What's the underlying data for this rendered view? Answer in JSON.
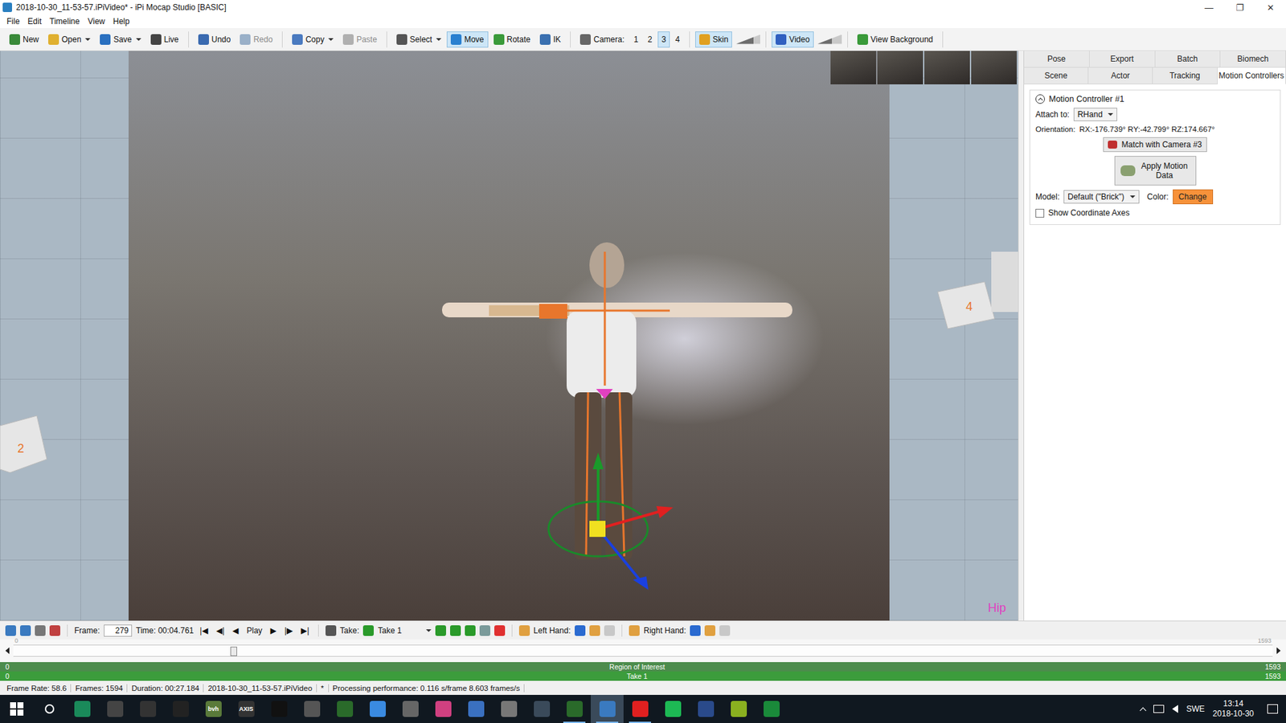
{
  "window": {
    "title": "2018-10-30_11-53-57.iPiVideo* - iPi Mocap Studio [BASIC]",
    "controls": [
      "—",
      "❐",
      "✕"
    ]
  },
  "menu": [
    "File",
    "Edit",
    "Timeline",
    "View",
    "Help"
  ],
  "toolbar": [
    [
      {
        "label": "New",
        "kind": "icon-button",
        "selected": false,
        "disabled": false,
        "dropdown": false,
        "opacity": null
      },
      {
        "label": "Open",
        "kind": "icon-button",
        "selected": false,
        "disabled": false,
        "dropdown": true,
        "opacity": null
      },
      {
        "label": "Save",
        "kind": "icon-button",
        "selected": false,
        "disabled": false,
        "dropdown": true,
        "opacity": null
      },
      {
        "label": "Live",
        "kind": "icon-button",
        "selected": false,
        "disabled": false,
        "dropdown": false,
        "opacity": null
      }
    ],
    [
      {
        "label": "Undo",
        "kind": "icon-button",
        "selected": false,
        "disabled": false,
        "dropdown": false,
        "opacity": null
      },
      {
        "label": "Redo",
        "kind": "icon-button",
        "selected": false,
        "disabled": true,
        "dropdown": false,
        "opacity": null
      }
    ],
    [
      {
        "label": "Copy",
        "kind": "icon-button",
        "selected": false,
        "disabled": false,
        "dropdown": true,
        "opacity": null
      },
      {
        "label": "Paste",
        "kind": "icon-button",
        "selected": false,
        "disabled": true,
        "dropdown": false,
        "opacity": null
      }
    ],
    [
      {
        "label": "Select",
        "kind": "icon-button",
        "selected": false,
        "disabled": false,
        "dropdown": true,
        "opacity": null
      },
      {
        "label": "Move",
        "kind": "icon-button",
        "selected": true,
        "disabled": false,
        "dropdown": false,
        "opacity": null
      },
      {
        "label": "Rotate",
        "kind": "icon-button",
        "selected": false,
        "disabled": false,
        "dropdown": false,
        "opacity": null
      },
      {
        "label": "IK",
        "kind": "icon-button",
        "selected": false,
        "disabled": false,
        "dropdown": false,
        "opacity": null
      }
    ],
    [
      {
        "label": "Camera:",
        "kind": "label",
        "selected": false,
        "disabled": false,
        "dropdown": false,
        "opacity": null
      },
      {
        "label": "1",
        "kind": "text-button",
        "selected": false,
        "disabled": false,
        "dropdown": false,
        "opacity": null
      },
      {
        "label": "2",
        "kind": "text-button",
        "selected": false,
        "disabled": false,
        "dropdown": false,
        "opacity": null
      },
      {
        "label": "3",
        "kind": "text-button",
        "selected": true,
        "disabled": false,
        "dropdown": false,
        "opacity": null
      },
      {
        "label": "4",
        "kind": "text-button",
        "selected": false,
        "disabled": false,
        "dropdown": false,
        "opacity": null
      }
    ],
    [
      {
        "label": "Skin",
        "kind": "icon-button",
        "selected": true,
        "disabled": false,
        "dropdown": false,
        "opacity": 0.7
      }
    ],
    [
      {
        "label": "Video",
        "kind": "icon-button",
        "selected": true,
        "disabled": false,
        "dropdown": false,
        "opacity": 0.6
      }
    ],
    [
      {
        "label": "View Background",
        "kind": "icon-button",
        "selected": false,
        "disabled": false,
        "dropdown": false,
        "opacity": null
      }
    ]
  ],
  "viewport": {
    "camera_labels": [
      "2",
      "4"
    ],
    "bone": "Hip"
  },
  "panel": {
    "tabs_row1": [
      {
        "label": "Pose",
        "selected": false
      },
      {
        "label": "Export",
        "selected": false
      },
      {
        "label": "Batch",
        "selected": false
      },
      {
        "label": "Biomech",
        "selected": false
      }
    ],
    "tabs_row2": [
      {
        "label": "Scene",
        "selected": false
      },
      {
        "label": "Actor",
        "selected": false
      },
      {
        "label": "Tracking",
        "selected": false
      },
      {
        "label": "Motion Controllers",
        "selected": true
      }
    ],
    "group": {
      "title": "Motion Controller #1",
      "expanded": true,
      "attach_label": "Attach to:",
      "attach_value": "RHand",
      "orientation_label": "Orientation:",
      "orientation_value": "RX:-176.739° RY:-42.799° RZ:174.667°",
      "match_button": "Match with Camera #3",
      "apply_button": "Apply Motion Data",
      "model_label": "Model:",
      "model_value": "Default (\"Brick\")",
      "color_label": "Color:",
      "color_button": "Change",
      "color": "#f7923a",
      "show_axes": {
        "label": "Show Coordinate Axes",
        "checked": false
      }
    }
  },
  "timeline": {
    "frame_label": "Frame:",
    "frame": "279",
    "time": "Time: 00:04.761",
    "nav": [
      "|◀",
      "◀|",
      "◀",
      "Play",
      "▶",
      "|▶",
      "▶|"
    ],
    "take_label": "Take:",
    "take": "Take 1",
    "left_hand": "Left Hand:",
    "right_hand": "Right Hand:",
    "slider": {
      "start": "0",
      "end": "1593",
      "level": 0.175
    },
    "roi": {
      "label": "Region of Interest",
      "start": "0",
      "end": "1593"
    },
    "take_bar": {
      "label": "Take 1",
      "start": "0",
      "end": "1593"
    }
  },
  "status": [
    "Frame Rate: 58.6",
    "Frames: 1594",
    "Duration: 00:27.184",
    "2018-10-30_11-53-57.iPiVideo",
    "*",
    "Processing performance: 0.116 s/frame 8.603 frames/s"
  ],
  "taskbar": {
    "apps": [
      {
        "label": "",
        "running": false,
        "selected": false
      },
      {
        "label": "",
        "running": false,
        "selected": false
      },
      {
        "label": "",
        "running": false,
        "selected": false
      },
      {
        "label": "",
        "running": false,
        "selected": false
      },
      {
        "label": "bvh",
        "running": false,
        "selected": false
      },
      {
        "label": "AXIS",
        "running": false,
        "selected": false
      },
      {
        "label": "",
        "running": false,
        "selected": false
      },
      {
        "label": "",
        "running": false,
        "selected": false
      },
      {
        "label": "",
        "running": false,
        "selected": false
      },
      {
        "label": "",
        "running": false,
        "selected": false
      },
      {
        "label": "",
        "running": false,
        "selected": false
      },
      {
        "label": "",
        "running": false,
        "selected": false
      },
      {
        "label": "",
        "running": false,
        "selected": false
      },
      {
        "label": "",
        "running": false,
        "selected": false
      },
      {
        "label": "",
        "running": false,
        "selected": false
      },
      {
        "label": "",
        "running": true,
        "selected": false
      },
      {
        "label": "",
        "running": true,
        "selected": true
      },
      {
        "label": "",
        "running": true,
        "selected": false
      },
      {
        "label": "",
        "running": false,
        "selected": false
      },
      {
        "label": "",
        "running": false,
        "selected": false
      },
      {
        "label": "",
        "running": false,
        "selected": false
      },
      {
        "label": "",
        "running": false,
        "selected": false
      }
    ],
    "lang": "SWE",
    "time": "13:14",
    "date": "2018-10-30"
  }
}
